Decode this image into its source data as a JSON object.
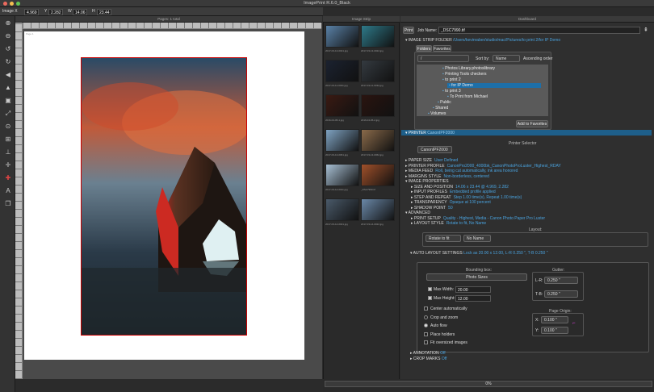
{
  "window": {
    "title": "ImagePrint R.6.0_Black"
  },
  "info": {
    "x_label": "Image X",
    "x_val": "4.969",
    "y_label": "Y",
    "y_val": "2.282",
    "w_label": "W",
    "w_val": "14.06",
    "h_label": "H",
    "h_val": "23.44"
  },
  "canvas": {
    "header": "Pages: 1 total",
    "page_label": "Page 1"
  },
  "strip": {
    "header": "Image Strip",
    "thumbs": [
      {
        "cap": "2017-03-13-0021.jpg",
        "color": "#5a82a8"
      },
      {
        "cap": "2017-03-13-0022.jpg",
        "color": "#2e7a8a"
      },
      {
        "cap": "2017-03-11-0031.jpg",
        "color": "#1b2230"
      },
      {
        "cap": "2017-03-11-0032.jpg",
        "color": "#343a40"
      },
      {
        "cap": "2016-04-05-1.jpg",
        "color": "#3a1a12"
      },
      {
        "cap": "2016-04-05-2.jpg",
        "color": "#2a1410"
      },
      {
        "cap": "2017-03-13-0061.jpg",
        "color": "#7fa3c2"
      },
      {
        "cap": "2017-03-13-0062.jpg",
        "color": "#8a6a4a"
      },
      {
        "cap": "2017-03-14-0011.jpg",
        "color": "#a8c0d4"
      },
      {
        "cap": "_DSC7990.tif",
        "color": "#a0502a"
      },
      {
        "cap": "2017-03-14-0021.jpg",
        "color": "#4a5a6a"
      },
      {
        "cap": "2017-03-14-0022.jpg",
        "color": "#6a88a8"
      }
    ]
  },
  "dash": {
    "header": "Dashboard",
    "print_btn": "Print",
    "job_label": "Job Name:",
    "job_value": "_DSC7990.tif",
    "strip_folder_label": "IMAGE STRIP FOLDER",
    "strip_folder_path": "/Users/kevinraber/studio/mac/Pictures/to print 2/for IP Demo",
    "tabs": [
      "Folders",
      "Favorites"
    ],
    "root_sel": "/",
    "sort_label": "Sort by:",
    "sort_val": "Name",
    "order": "Ascending order",
    "tree": [
      "Photos Library.photoslibrary",
      "Printing Tools checkers",
      "to print 2",
      "for IP Demo",
      "to print 3",
      "To Print from Michael",
      "Public",
      "Shared",
      "Volumes"
    ],
    "fav_btn": "Add to Favorites",
    "printer_label": "PRINTER",
    "printer_name": "CanonIPF2000",
    "printer_selector": "Printer Selector",
    "printer_sel": "CanonIPF2000",
    "props": [
      {
        "k": "PAPER SIZE",
        "v": "User Defined",
        "indent": 0
      },
      {
        "k": "PRINTER PROFILE",
        "v": "CanonPro2000_4000bk_CanonPhotoProLuster_Highest_RDAY",
        "indent": 0
      },
      {
        "k": "MEDIA FEED",
        "v": "Roll, being cut automatically, ink area honored",
        "indent": 0
      },
      {
        "k": "MARGINS STYLE",
        "v": "Non-borderless, centered",
        "indent": 0
      },
      {
        "k": "IMAGE PROPERTIES",
        "v": "",
        "indent": 0
      },
      {
        "k": "SIZE AND POSITION",
        "v": "14.06 x 23.44 @ 4.969, 2.282",
        "indent": 1
      },
      {
        "k": "INPUT PROFILES",
        "v": "Embedded profile applied",
        "indent": 1
      },
      {
        "k": "STEP AND REPEAT",
        "v": "Step 1.00 time(s), Repeat 1.00 time(s)",
        "indent": 1
      },
      {
        "k": "TRANSPARENCY",
        "v": "Opaque at 100 percent",
        "indent": 1
      },
      {
        "k": "SHADOW POINT",
        "v": "50",
        "indent": 1
      },
      {
        "k": "ADVANCED",
        "v": "",
        "indent": 0
      },
      {
        "k": "PRINT SETUP",
        "v": "Quality - Highest, Media - Canon Photo Paper Pro Luster",
        "indent": 1
      },
      {
        "k": "LAYOUT STYLE",
        "v": "Rotate to fit, No Name",
        "indent": 1
      }
    ],
    "layout_title": "Layout:",
    "layout_sel1": "Rotate to fit",
    "layout_sel2": "No Name",
    "auto_label": "AUTO LAYOUT SETTINGS",
    "auto_val": "Lock as 20.00 x 12.00, L-R 0.250 \", T-B 0.250 \"",
    "bbox_title": "Bounding box:",
    "bbox_sel": "Photo Sizes",
    "maxw_label": "Max Width:",
    "maxw_val": "20.00",
    "maxh_label": "Max Height:",
    "maxh_val": "12.00",
    "gutter_title": "Gutter:",
    "lr_label": "L-R:",
    "lr_val": "0.250 \"",
    "tb_label": "T-B:",
    "tb_val": "0.250 \"",
    "opts": [
      {
        "label": "Center automatically",
        "type": "chk",
        "on": false
      },
      {
        "label": "Crop and zoom",
        "type": "radio",
        "on": false
      },
      {
        "label": "Auto flow",
        "type": "radio",
        "on": true
      },
      {
        "label": "Place holders",
        "type": "chk",
        "on": false
      },
      {
        "label": "Fit oversized images",
        "type": "chk",
        "on": false
      }
    ],
    "origin_title": "Page Origin:",
    "ox_label": "X:",
    "ox_val": "0.100 \"",
    "oy_label": "Y:",
    "oy_val": "0.100 \"",
    "annotation_label": "ANNOTATION",
    "annotation_val": "Off",
    "crop_label": "CROP MARKS",
    "crop_val": "Off"
  },
  "status": {
    "progress": "0%"
  }
}
